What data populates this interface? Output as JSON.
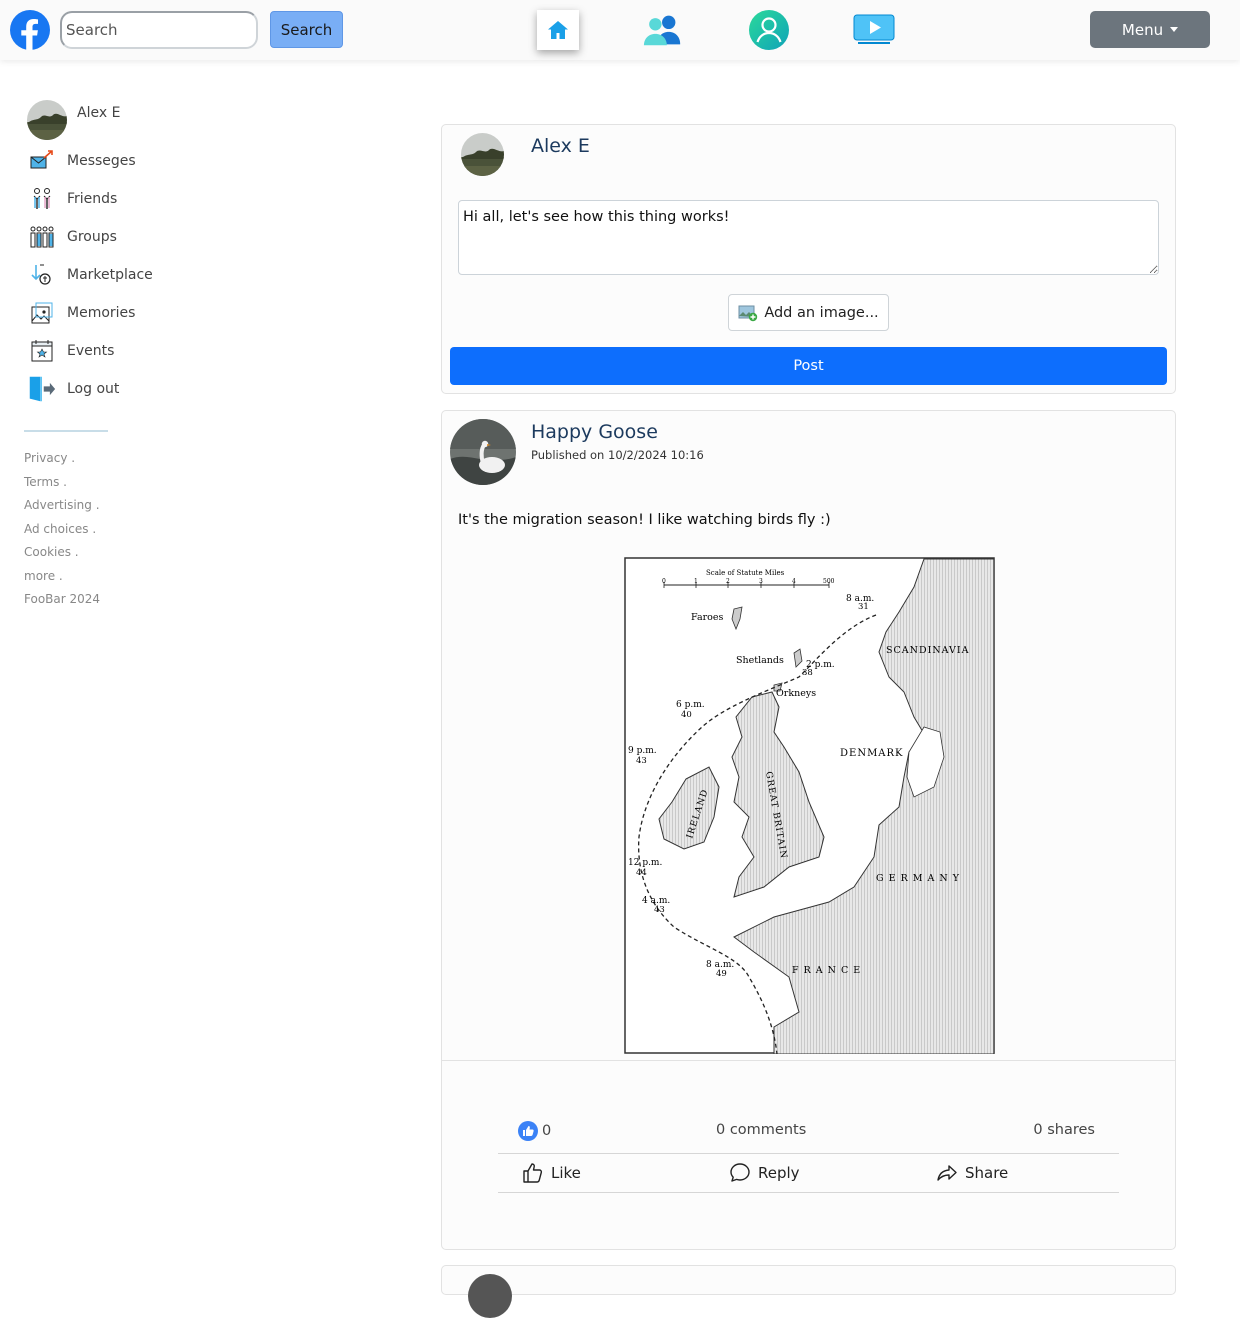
{
  "header": {
    "search_placeholder": "Search",
    "search_button": "Search",
    "menu_label": "Menu",
    "nav": [
      "home-icon",
      "friends-icon",
      "profile-icon",
      "video-icon"
    ],
    "accent": "#0d6efd"
  },
  "sidebar": {
    "user_name": "Alex E",
    "items": [
      {
        "label": "Messeges",
        "icon": "messages-icon"
      },
      {
        "label": "Friends",
        "icon": "friends-icon"
      },
      {
        "label": "Groups",
        "icon": "groups-icon"
      },
      {
        "label": "Marketplace",
        "icon": "marketplace-icon"
      },
      {
        "label": "Memories",
        "icon": "memories-icon"
      },
      {
        "label": "Events",
        "icon": "events-icon"
      },
      {
        "label": "Log out",
        "icon": "logout-icon"
      }
    ],
    "footer": [
      "Privacy .",
      "Terms .",
      "Advertising .",
      "Ad choices .",
      "Cookies .",
      "more .",
      "FooBar 2024"
    ]
  },
  "composer": {
    "user_name": "Alex E",
    "text": "Hi all, let's see how this thing works!",
    "add_image": "Add an image...",
    "post_button": "Post"
  },
  "post": {
    "author": "Happy Goose",
    "published": "Published on 10/2/2024 10:16",
    "text": "It's the migration season! I like watching birds fly :)",
    "likes": "0",
    "comments": "0 comments",
    "shares": "0 shares",
    "actions": {
      "like": "Like",
      "reply": "Reply",
      "share": "Share"
    },
    "map": {
      "scale_title": "Scale of Statute Miles",
      "scale_ticks": [
        "0",
        "1",
        "2",
        "3",
        "4",
        "500"
      ],
      "labels": {
        "faroes": "Faroes",
        "shetlands": "Shetlands",
        "orkneys": "Orkneys",
        "scandinavia": "SCANDINAVIA",
        "denmark": "DENMARK",
        "ireland": "IRELAND",
        "great_britain": "GREAT BRITAIN",
        "germany": "G E R M A N Y",
        "france": "F R A N C E"
      },
      "times": [
        {
          "time": "8 a.m.",
          "num": "31"
        },
        {
          "time": "2 p.m.",
          "num": "38"
        },
        {
          "time": "6 p.m.",
          "num": "40"
        },
        {
          "time": "9 p.m.",
          "num": "43"
        },
        {
          "time": "12 p.m.",
          "num": "44"
        },
        {
          "time": "4 a.m.",
          "num": "43"
        },
        {
          "time": "8 a.m.",
          "num": "49"
        }
      ]
    }
  }
}
